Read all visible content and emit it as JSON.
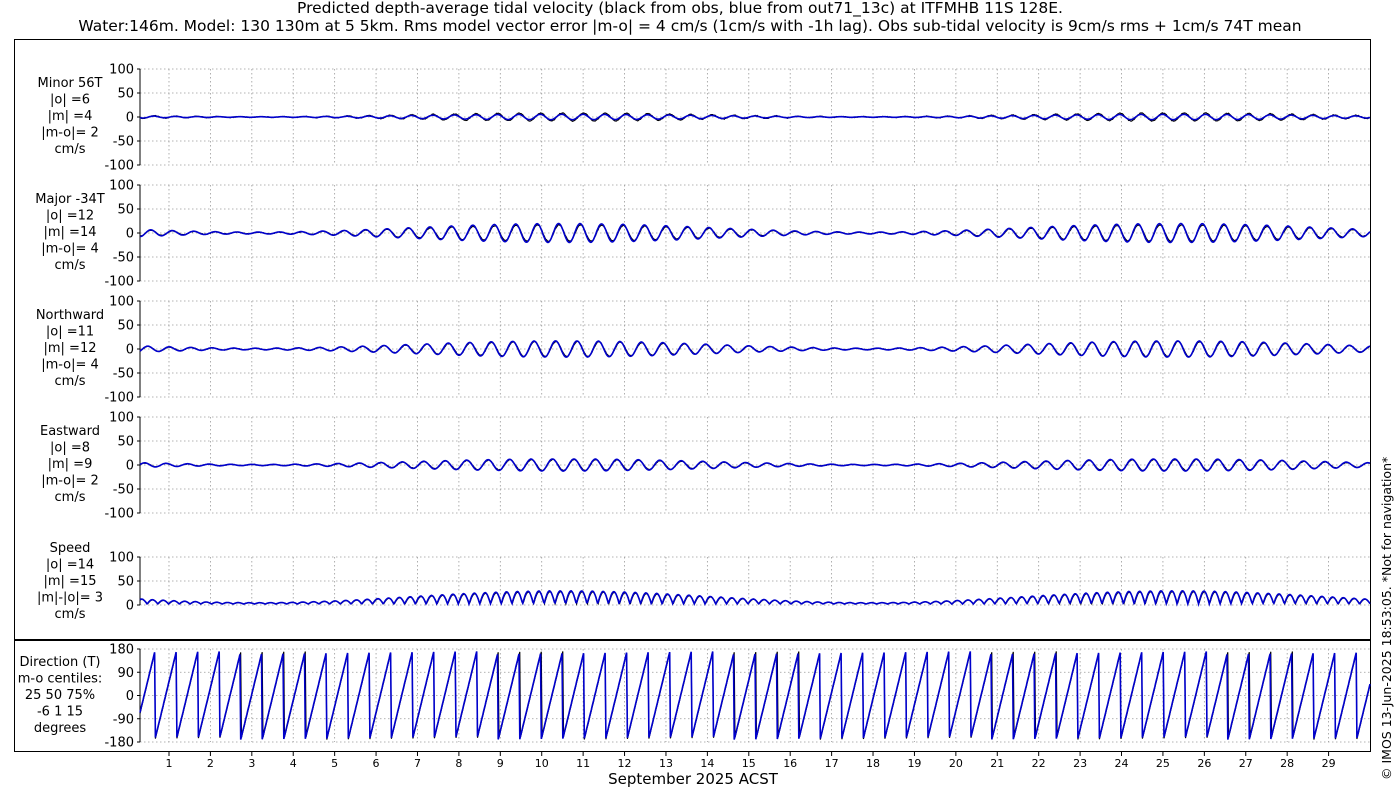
{
  "title_line1": "Predicted depth-average tidal velocity (black from obs, blue from out71_13c) at ITFMHB 11S 128E.",
  "title_line2": "Water:146m. Model: 130 130m at 5 5km. Rms model vector error |m-o| = 4 cm/s (1cm/s with -1h lag). Obs sub-tidal velocity is 9cm/s rms + 1cm/s 74T mean",
  "watermark": "© IMOS 13-Jun-2025 18:53:05. *Not for navigation*",
  "colors": {
    "obs": "#000000",
    "model": "#0000cc",
    "grid": "#9a9a9a"
  },
  "chart_data": {
    "type": "line",
    "xlabel": "September 2025 ACST",
    "x_ticks": [
      "1",
      "2",
      "3",
      "4",
      "5",
      "6",
      "7",
      "8",
      "9",
      "10",
      "11",
      "12",
      "13",
      "14",
      "15",
      "16",
      "17",
      "18",
      "19",
      "20",
      "21",
      "22",
      "23",
      "24",
      "25",
      "26",
      "27",
      "28",
      "29"
    ],
    "xlim_days": [
      0.3,
      30
    ],
    "series_names": [
      "obs",
      "model"
    ],
    "panels": [
      {
        "key": "minor",
        "label_lines": [
          "Minor 56T",
          "|o| =6",
          "|m| =4",
          "|m-o|= 2",
          "cm/s"
        ],
        "ylim": [
          -100,
          100
        ],
        "yticks": [
          "100",
          "50",
          "0",
          "-50",
          "-100"
        ],
        "obs_rms": 6,
        "model_rms": 4,
        "err_rms": 2
      },
      {
        "key": "major",
        "label_lines": [
          "Major -34T",
          "|o| =12",
          "|m| =14",
          "|m-o|= 4",
          "cm/s"
        ],
        "ylim": [
          -100,
          100
        ],
        "yticks": [
          "100",
          "50",
          "0",
          "-50",
          "-100"
        ],
        "obs_rms": 12,
        "model_rms": 14,
        "err_rms": 4
      },
      {
        "key": "north",
        "label_lines": [
          "Northward",
          "|o| =11",
          "|m| =12",
          "|m-o|= 4",
          "cm/s"
        ],
        "ylim": [
          -100,
          100
        ],
        "yticks": [
          "100",
          "50",
          "0",
          "-50",
          "-100"
        ],
        "obs_rms": 11,
        "model_rms": 12,
        "err_rms": 4
      },
      {
        "key": "east",
        "label_lines": [
          "Eastward",
          "|o| =8",
          "|m| =9",
          "|m-o|= 2",
          "cm/s"
        ],
        "ylim": [
          -100,
          100
        ],
        "yticks": [
          "100",
          "50",
          "0",
          "-50",
          "-100"
        ],
        "obs_rms": 8,
        "model_rms": 9,
        "err_rms": 2
      },
      {
        "key": "speed",
        "label_lines": [
          "Speed",
          "|o| =14",
          "|m| =15",
          "|m|-|o|= 3",
          "cm/s"
        ],
        "ylim": [
          0,
          100
        ],
        "yticks": [
          "100",
          "50",
          "0"
        ],
        "obs_rms": 14,
        "model_rms": 15,
        "err_rms": 3
      },
      {
        "key": "direction",
        "label_lines": [
          "Direction (T)",
          "m-o centiles:",
          "25  50  75%",
          "-6   1  15",
          "degrees"
        ],
        "ylim": [
          -180,
          180
        ],
        "yticks": [
          "180",
          "90",
          "0",
          "-90",
          "-180"
        ],
        "centiles": {
          "p25": -6,
          "p50": 1,
          "p75": 15
        }
      }
    ]
  }
}
